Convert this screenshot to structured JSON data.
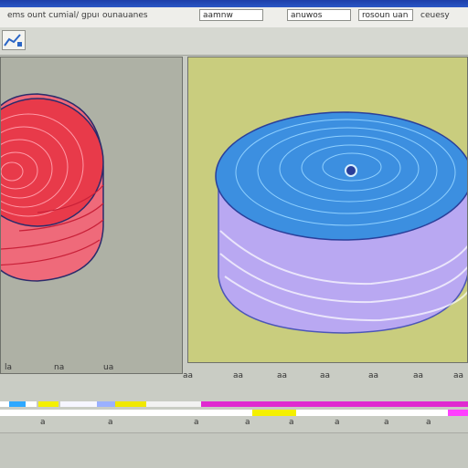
{
  "window": {
    "title_bar_color": "#1d3fa8"
  },
  "menu": {
    "items": [
      "ems ount cumial/ gpuue pauts",
      "ounauanes",
      "aamnw",
      "anuwos",
      "ceuesy"
    ],
    "dropdown_value": "rosoun uan"
  },
  "toolbar": {
    "chart_button_icon": "chart-icon"
  },
  "left_panel": {
    "object_color": "#e83a4a",
    "ticks": [
      "la",
      "na",
      "ua"
    ]
  },
  "right_panel": {
    "object_color": "#3c8fe0",
    "ticks": [
      "aa",
      "aa",
      "aa",
      "aa",
      "aa",
      "aa",
      "aa",
      "aa"
    ]
  },
  "colorbar": {
    "labels": [
      "a",
      "a",
      "a",
      "a",
      "a",
      "a",
      "a",
      "a"
    ],
    "colors": [
      "#2ea8ff",
      "#f4f000",
      "#9ab0ff",
      "#f0e800",
      "#e02ad0",
      "#ff40ff",
      "#ffffff"
    ]
  }
}
